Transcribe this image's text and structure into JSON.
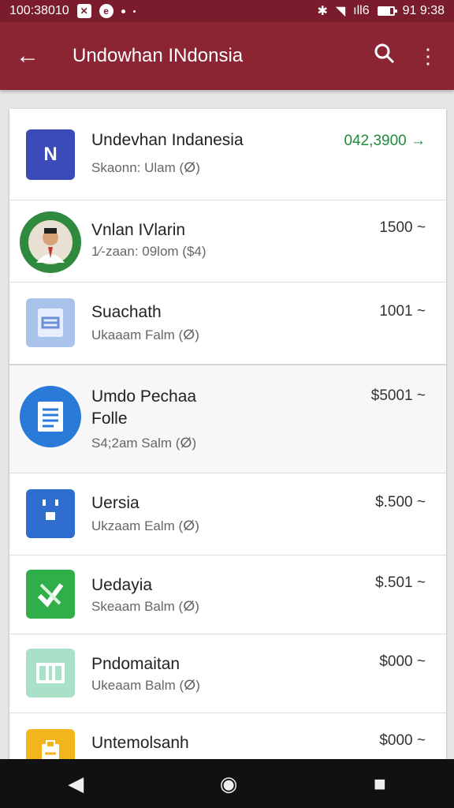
{
  "status_bar": {
    "left_text": "100:38010",
    "notif_icons": [
      "notification-box-icon",
      "notification-circle-icon"
    ],
    "right_signal": "ıll6",
    "time": "91 9:38"
  },
  "app_bar": {
    "back_glyph": "←",
    "title": "Undowhan INdonsia",
    "search_glyph": "🔍",
    "menu_glyph": "⋮"
  },
  "items": [
    {
      "name": "Undevhan Indanesia",
      "sub": "Skaonn: Ulam (ⵁ)",
      "price": "042,3900 →",
      "icon": "app-icon-onenote",
      "icon_text": "N",
      "color": "#3b4bb8"
    },
    {
      "name": "Vnlan IVlarin",
      "sub": "1⁄-zaan: 09lom ($4)",
      "price": "1500 ~",
      "icon": "app-icon-avatar",
      "icon_text": "👤",
      "color": "#2f8a3e"
    },
    {
      "name": "Suachath",
      "sub": "Ukaaam Falm (ⵁ)",
      "price": "1001 ~",
      "icon": "app-icon-slides",
      "icon_text": "▤",
      "color": "#a9c3ea"
    },
    {
      "name": "Umdo Pechaa",
      "name2": "Folle",
      "sub": "S4;2am Salm (ⵁ)",
      "price": "$5001 ~",
      "icon": "app-icon-docs",
      "icon_text": "≣",
      "color": "#2a7bd9"
    },
    {
      "name": "Uersia",
      "sub": "Ukzaam Ealm (ⵁ)",
      "price": "$.500 ~",
      "icon": "app-icon-calendar",
      "icon_text": "▣",
      "color": "#2f6ecf"
    },
    {
      "name": "Uedayia",
      "sub": "Skeaam Balm (ⵁ)",
      "price": "$.501 ~",
      "icon": "app-icon-tasks",
      "icon_text": "✓",
      "color": "#2fae49"
    },
    {
      "name": "Pndomaitan",
      "sub": "Ukeaam Balm (ⵁ)",
      "price": "$000 ~",
      "icon": "app-icon-sheets",
      "icon_text": "▥",
      "color": "#a8e0c8"
    },
    {
      "name": "Untemolsanh",
      "sub": "",
      "price": "$000 ~",
      "icon": "app-icon-clipboard",
      "icon_text": "▤",
      "color": "#f2b51c"
    }
  ],
  "nav_bar": {
    "back": "◀",
    "home": "◉",
    "recent": "■"
  }
}
